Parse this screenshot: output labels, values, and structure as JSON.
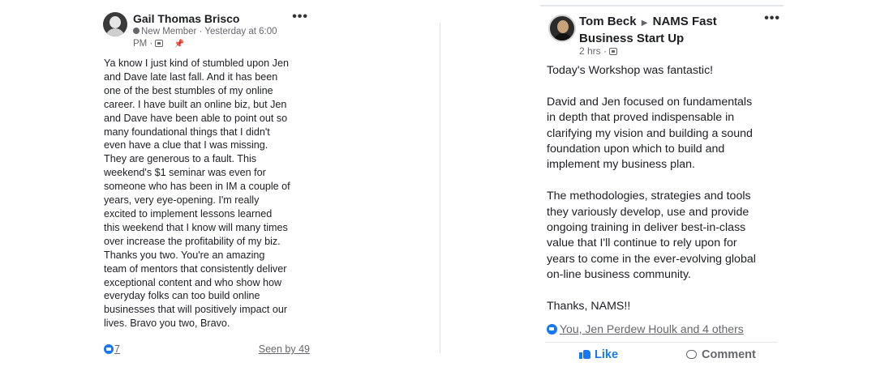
{
  "left_post": {
    "author": "Gail Thomas Brisco",
    "badge": "New Member",
    "timestamp_line1": "· Yesterday at 6:00",
    "timestamp_line2": "PM ·",
    "body": "Ya know I just kind of stumbled upon Jen\nand Dave late last fall.  And it has been\none of the best stumbles of my online\ncareer.  I have built an online biz, but Jen\nand Dave have been able to point out so\nmany foundational things that I didn't\neven have a clue that I was missing.\nThey are generous to a fault.  This\nweekend's $1 seminar was even for\nsomeone who has been in IM a couple of\nyears, very eye-opening.  I'm really\nexcited to implement lessons learned\nthis weekend that I know will many times\nover increase the profitability of my biz.\nThanks you two.  You're an amazing\nteam of mentors that consistently deliver\nexceptional content and who show how\neveryday folks can too build online\nbusinesses that will positively impact our\nlives.  Bravo you two, Bravo.",
    "reaction_count": "7",
    "seen_by": "Seen by 49",
    "more_glyph": "•••"
  },
  "right_post": {
    "author": "Tom Beck",
    "arrow_glyph": "▶",
    "group": "NAMS Fast Business Start Up",
    "timestamp": "2 hrs ·",
    "body": "Today's Workshop was fantastic!\n\nDavid and Jen focused on fundamentals\nin depth that proved indispensable in\nclarifying my vision and building a sound\nfoundation upon which to build and\nimplement my business plan.\n\nThe methodologies, strategies and tools\nthey variously develop, use and provide\nongoing training in deliver best-in-class\nvalue that I'll continue to rely upon for\nyears to come in the ever-evolving global\non-line business community.\n\nThanks, NAMS!!",
    "reactions_text": "You, Jen Perdew Houlk and 4 others",
    "like_label": "Like",
    "comment_label": "Comment",
    "more_glyph": "•••"
  },
  "colors": {
    "accent": "#1877f2",
    "text": "#1c1e21",
    "muted": "#65676b"
  },
  "icons": [
    "globe-icon",
    "pin-icon",
    "group-icon",
    "like-reaction-icon",
    "thumbs-up-icon",
    "comment-icon",
    "more-options-icon",
    "arrow-right-icon"
  ]
}
